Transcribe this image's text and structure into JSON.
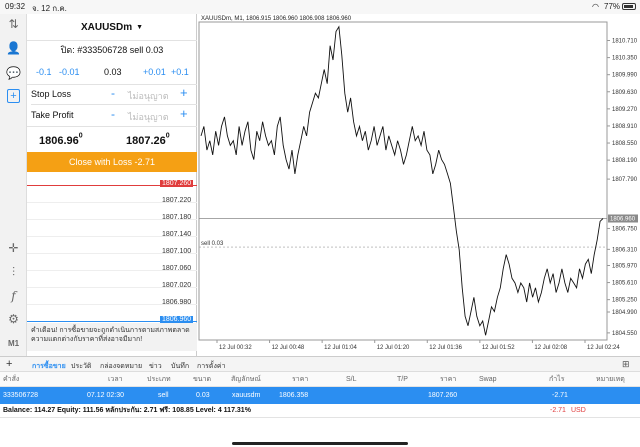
{
  "status": {
    "time": "09:32",
    "date": "จ. 12 ก.ค.",
    "battery": "77%"
  },
  "order": {
    "symbol": "XAUUSDm",
    "close_position": "ปิด: #333506728 sell 0.03",
    "steps": [
      "-0.1",
      "-0.01",
      "0.03",
      "+0.01",
      "+0.1"
    ],
    "stop_loss_label": "Stop Loss",
    "stop_loss_value": "ไม่อนุญาต",
    "take_profit_label": "Take Profit",
    "take_profit_value": "ไม่อนุญาต",
    "bid_main": "1806.96",
    "bid_sup": "0",
    "ask_main": "1807.26",
    "ask_sup": "0",
    "close_button": "Close with Loss -2.71",
    "depth_prices": [
      "1807.260",
      "1807.220",
      "1807.180",
      "1807.140",
      "1807.100",
      "1807.060",
      "1807.020",
      "1806.980",
      "1806.960"
    ],
    "warning": "คำเตือน! การซื้อขายจะถูกดำเนินการตามสภาพตลาด ความแตกต่างกับราคาที่ส่งอาจมีมาก!"
  },
  "chart_data": {
    "type": "line",
    "title": "XAUUSDm, M1, 1806.915 1806.960 1806.908 1806.960",
    "ylim": [
      1804.4,
      1811.1
    ],
    "yticks": [
      1810.71,
      1810.35,
      1809.99,
      1809.63,
      1809.27,
      1808.91,
      1808.55,
      1808.19,
      1807.79,
      1806.75,
      1806.31,
      1805.97,
      1805.61,
      1805.25,
      1804.99,
      1804.55
    ],
    "yticks_display": [
      "1810.710",
      "1810.350",
      "1809.990",
      "1809.630",
      "1809.270",
      "1808.910",
      "1808.550",
      "1808.190",
      "1807.790",
      "1806.750",
      "1806.310",
      "1805.970",
      "1805.610",
      "1805.250",
      "1804.990",
      "1804.550"
    ],
    "xticks": [
      "12 Jul 00:32",
      "12 Jul 00:48",
      "12 Jul 01:04",
      "12 Jul 01:20",
      "12 Jul 01:36",
      "12 Jul 01:52",
      "12 Jul 02:08",
      "12 Jul 02:24"
    ],
    "current_price": "1806.960",
    "current_value": 1806.96,
    "sell_label": "sell 0.03",
    "sell_value": 1806.358,
    "values": [
      1808.7,
      1808.9,
      1808.4,
      1808.6,
      1808.3,
      1808.8,
      1808.5,
      1808.9,
      1809.1,
      1808.7,
      1808.5,
      1808.6,
      1808.3,
      1808.9,
      1808.5,
      1808.8,
      1809.0,
      1808.4,
      1808.2,
      1808.8,
      1808.6,
      1809.0,
      1808.7,
      1808.5,
      1808.6,
      1808.3,
      1808.9,
      1809.1,
      1808.5,
      1808.2,
      1808.0,
      1808.4,
      1807.9,
      1808.3,
      1808.6,
      1808.9,
      1808.7,
      1809.2,
      1809.4,
      1809.6,
      1809.5,
      1809.8,
      1810.1,
      1809.8,
      1810.6,
      1810.3,
      1810.9,
      1811.0,
      1810.4,
      1809.6,
      1809.2,
      1809.5,
      1809.0,
      1808.7,
      1808.9,
      1808.6,
      1808.8,
      1808.4,
      1808.6,
      1808.9,
      1808.5,
      1808.7,
      1808.9,
      1808.4,
      1808.7,
      1808.5,
      1808.3,
      1808.6,
      1808.4,
      1808.1,
      1808.3,
      1808.6,
      1808.9,
      1808.6,
      1808.7,
      1808.5,
      1808.8,
      1808.4,
      1808.3,
      1807.9,
      1808.1,
      1808.4,
      1808.2,
      1808.1,
      1807.9,
      1807.7,
      1807.2,
      1806.7,
      1806.3,
      1805.5,
      1804.9,
      1804.7,
      1805.0,
      1805.3,
      1804.9,
      1804.7,
      1804.8,
      1804.5,
      1804.8,
      1805.1,
      1805.0,
      1805.3,
      1805.5,
      1805.9,
      1806.2,
      1806.0,
      1805.7,
      1805.6,
      1805.4,
      1805.6,
      1805.5,
      1805.2,
      1805.6,
      1805.3,
      1805.5,
      1805.2,
      1805.4,
      1805.7,
      1805.9,
      1805.6,
      1805.8,
      1805.4,
      1805.6,
      1805.9,
      1805.6,
      1805.4,
      1805.7,
      1805.6,
      1805.5,
      1805.9,
      1805.7,
      1806.0,
      1806.1,
      1805.8,
      1806.2,
      1806.5,
      1806.9,
      1806.96
    ]
  },
  "tabs": [
    "การซื้อขาย",
    "ประวัติ",
    "กล่องจดหมาย",
    "ข่าว",
    "บันทึก",
    "การตั้งค่า"
  ],
  "table": {
    "headers": [
      "คำสั่ง",
      "เวลา",
      "ประเภท",
      "ขนาด",
      "สัญลักษณ์",
      "ราคา",
      "S/L",
      "T/P",
      "ราคา",
      "Swap",
      "กำไร",
      "หมายเหตุ"
    ],
    "row": [
      "333506728",
      "07.12 02:30",
      "sell",
      "0.03",
      "xauusdm",
      "1806.358",
      "",
      "",
      "1807.260",
      "",
      "-2.71",
      ""
    ],
    "balance": "Balance: 114.27 Equity: 111.56 หลักประกัน: 2.71 ฟรี: 108.85 Level: 4 117.31%",
    "balance_profit": "-2.71",
    "currency": "USD"
  },
  "colors": {
    "accent": "#2b8ef1",
    "orange": "#f5a014",
    "red": "#e03c3c"
  }
}
